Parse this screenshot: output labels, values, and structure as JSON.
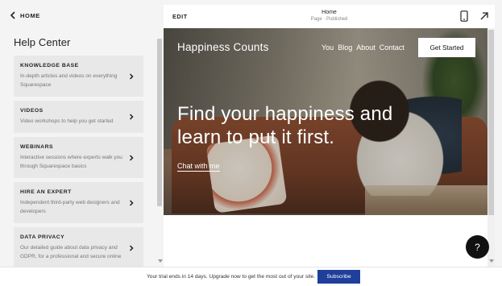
{
  "sidebar": {
    "back_label": "HOME",
    "title": "Help Center",
    "cards": [
      {
        "title": "KNOWLEDGE BASE",
        "desc": "In-depth articles and videos on everything Squarespace"
      },
      {
        "title": "VIDEOS",
        "desc": "Video workshops to help you get started"
      },
      {
        "title": "WEBINARS",
        "desc": "Interactive sessions where experts walk you through Squarespace basics"
      },
      {
        "title": "HIRE AN EXPERT",
        "desc": "Independent third-party web designers and developers"
      },
      {
        "title": "DATA PRIVACY",
        "desc": "Our detailed guide about data privacy and GDPR, for a professional and secure online"
      }
    ]
  },
  "preview_header": {
    "edit_label": "EDIT",
    "page_name": "Home",
    "page_status": "Page · Published",
    "device_icon": "mobile-phone-icon",
    "expand_icon": "arrow-up-right-icon"
  },
  "site": {
    "title": "Happiness Counts",
    "nav": [
      "You",
      "Blog",
      "About",
      "Contact"
    ],
    "cta_label": "Get Started",
    "headline": "Find your happiness and learn to put it first.",
    "chat_link": "Chat with me"
  },
  "help_fab_label": "?",
  "trial_bar": {
    "text": "Your trial ends in 14 days. Upgrade now to get the most out of your site.",
    "subscribe_label": "Subscribe",
    "button_color": "#1f3f9a"
  }
}
